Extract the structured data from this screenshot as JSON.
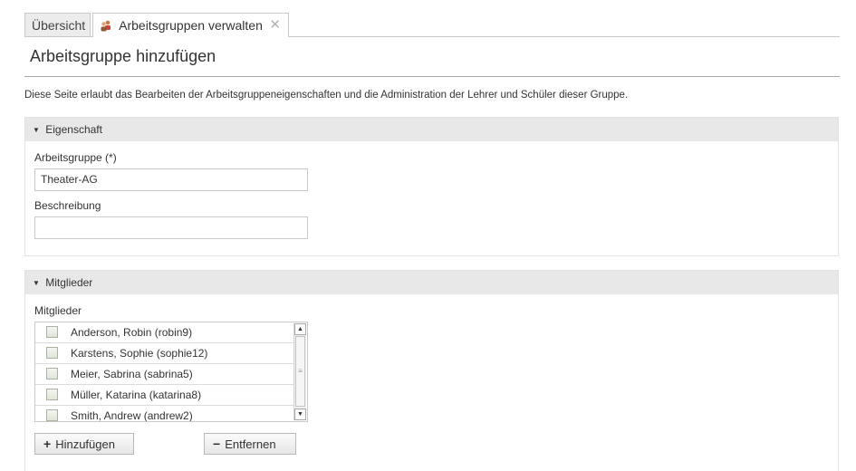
{
  "tabs": {
    "overview_label": "Übersicht",
    "active_label": "Arbeitsgruppen verwalten",
    "active_icon": "users-icon",
    "close_icon": "close-icon"
  },
  "page": {
    "title": "Arbeitsgruppe hinzufügen",
    "intro": "Diese Seite erlaubt das Bearbeiten der Arbeitsgruppeneigenschaften und die Administration der Lehrer und Schüler dieser Gruppe."
  },
  "properties": {
    "heading": "Eigenschaft",
    "group_label": "Arbeitsgruppe (*)",
    "group_value": "Theater-AG",
    "description_label": "Beschreibung",
    "description_value": ""
  },
  "members": {
    "heading": "Mitglieder",
    "list_label": "Mitglieder",
    "items": [
      "Anderson, Robin (robin9)",
      "Karstens, Sophie (sophie12)",
      "Meier, Sabrina (sabrina5)",
      "Müller, Katarina (katarina8)",
      "Smith, Andrew (andrew2)"
    ],
    "add_label": "Hinzufügen",
    "remove_label": "Entfernen"
  },
  "colors": {
    "section_header_bg": "#e8e8e8",
    "border": "#c9c9c9"
  }
}
